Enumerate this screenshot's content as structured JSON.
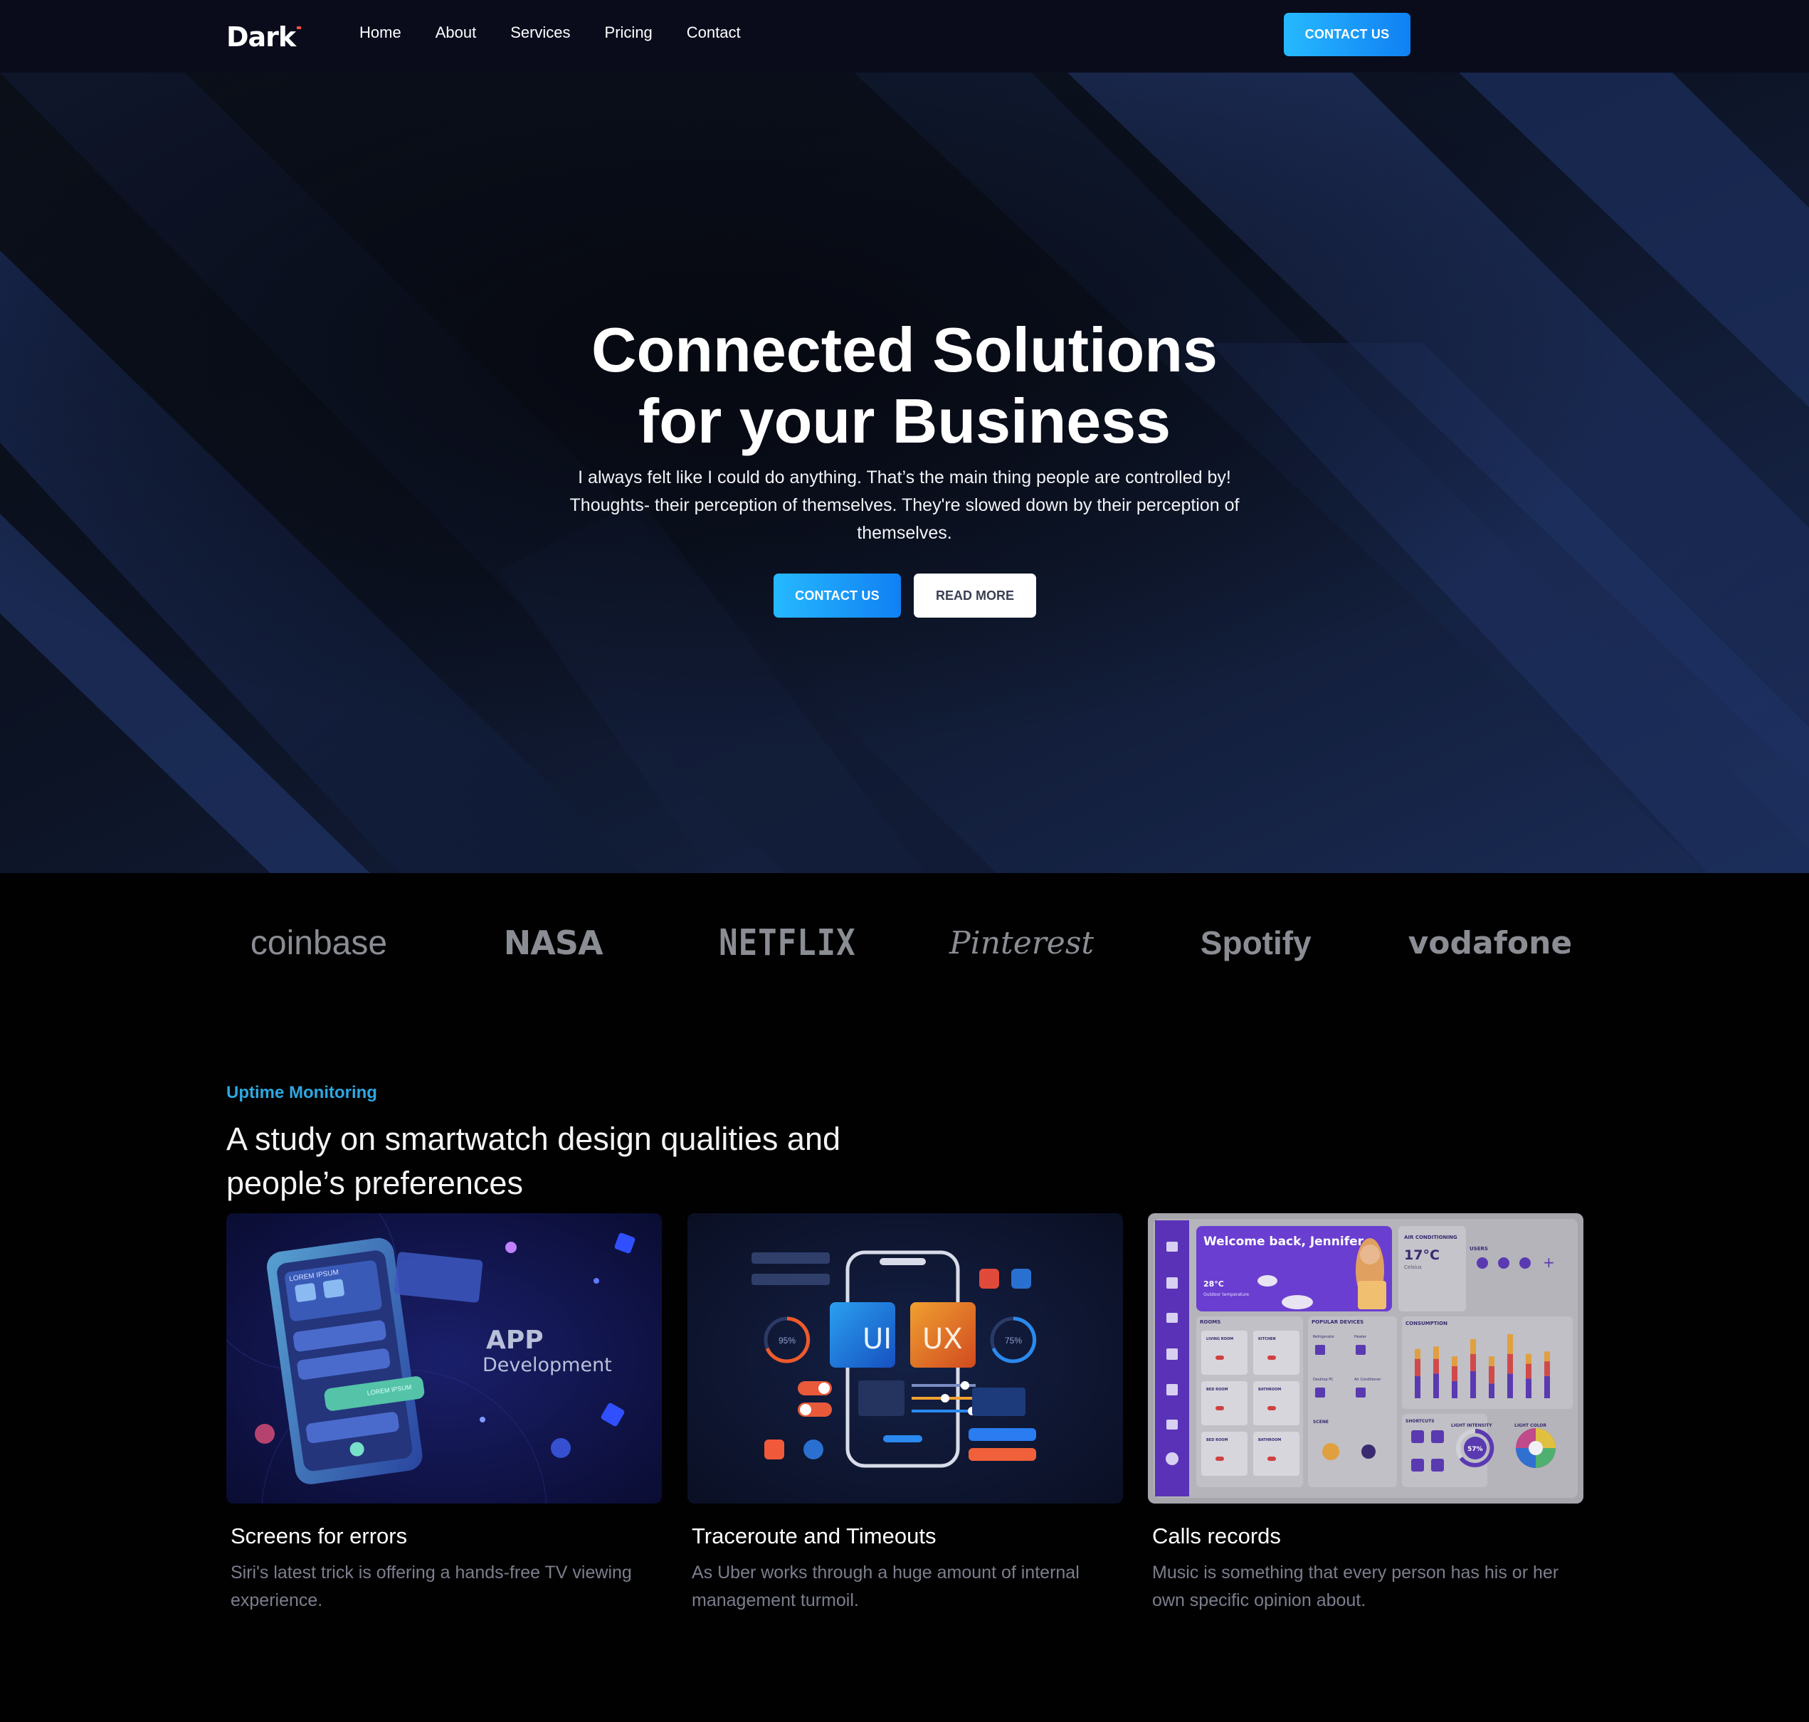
{
  "nav": {
    "logo": "Dark",
    "links": [
      "Home",
      "About",
      "Services",
      "Pricing",
      "Contact"
    ],
    "cta": "CONTACT US"
  },
  "hero": {
    "title_line1": "Connected Solutions",
    "title_line2": "for your Business",
    "subtitle": "I always felt like I could do anything. That’s the main thing people are controlled by! Thoughts- their perception of themselves. They're slowed down by their perception of themselves.",
    "cta_primary": "CONTACT US",
    "cta_secondary": "READ MORE"
  },
  "brands": [
    "coinbase",
    "NASA",
    "NETFLIX",
    "Pinterest",
    "Spotify",
    "vodafone"
  ],
  "section": {
    "eyebrow": "Uptime Monitoring",
    "title": "A study on smartwatch design qualities and people’s preferences"
  },
  "cards": [
    {
      "title": "Screens for errors",
      "text": "Siri's latest trick is offering a hands-free TV viewing experience.",
      "image_text": {
        "big": "APP",
        "small": "Development",
        "screen_label": "LOREM IPSUM",
        "button_label": "LOREM IPSUM"
      }
    },
    {
      "title": "Traceroute and Timeouts",
      "text": "As Uber works through a huge amount of internal management turmoil.",
      "image_text": {
        "ui": "UI",
        "ux": "UX",
        "gauge_left": "95%",
        "gauge_right": "75%"
      }
    },
    {
      "title": "Calls records",
      "text": "Music is something that every person has his or her own specific opinion about.",
      "image_text": {
        "welcome": "Welcome back, Jennifer",
        "temp_out": "28°C",
        "temp_out_label": "Outdoor temperature",
        "ac_label": "AIR CONDITIONING",
        "ac_temp": "17°C",
        "ac_unit": "Celsius",
        "users_label": "USERS",
        "consumption_label": "CONSUMPTION",
        "rooms_label": "ROOMS",
        "devices_label": "POPULAR DEVICES",
        "shortcuts_label": "SHORTCUTS",
        "light_intensity": "LIGHT INTENSITY",
        "light_color": "LIGHT COLOR",
        "intensity_value": "57%",
        "rooms": [
          "LIVING ROOM",
          "KITCHEN",
          "BED ROOM",
          "BATHROOM",
          "BED ROOM",
          "BATHROOM"
        ],
        "devices": [
          "Refrigerator",
          "Heater",
          "Desktop PC",
          "Air Conditioner",
          "SCENE"
        ],
        "bars": [
          [
            0.45,
            0.35,
            0.2
          ],
          [
            0.5,
            0.3,
            0.25
          ],
          [
            0.35,
            0.3,
            0.2
          ],
          [
            0.55,
            0.35,
            0.3
          ],
          [
            0.3,
            0.35,
            0.2
          ],
          [
            0.5,
            0.4,
            0.4
          ],
          [
            0.4,
            0.3,
            0.2
          ],
          [
            0.45,
            0.3,
            0.2
          ]
        ]
      }
    }
  ],
  "colors": {
    "accent": "#2ea7e0",
    "button_gradient_start": "#26b9ff",
    "button_gradient_end": "#1080f3",
    "nav_bg": "#0a0c1c",
    "page_bg": "#010102"
  }
}
